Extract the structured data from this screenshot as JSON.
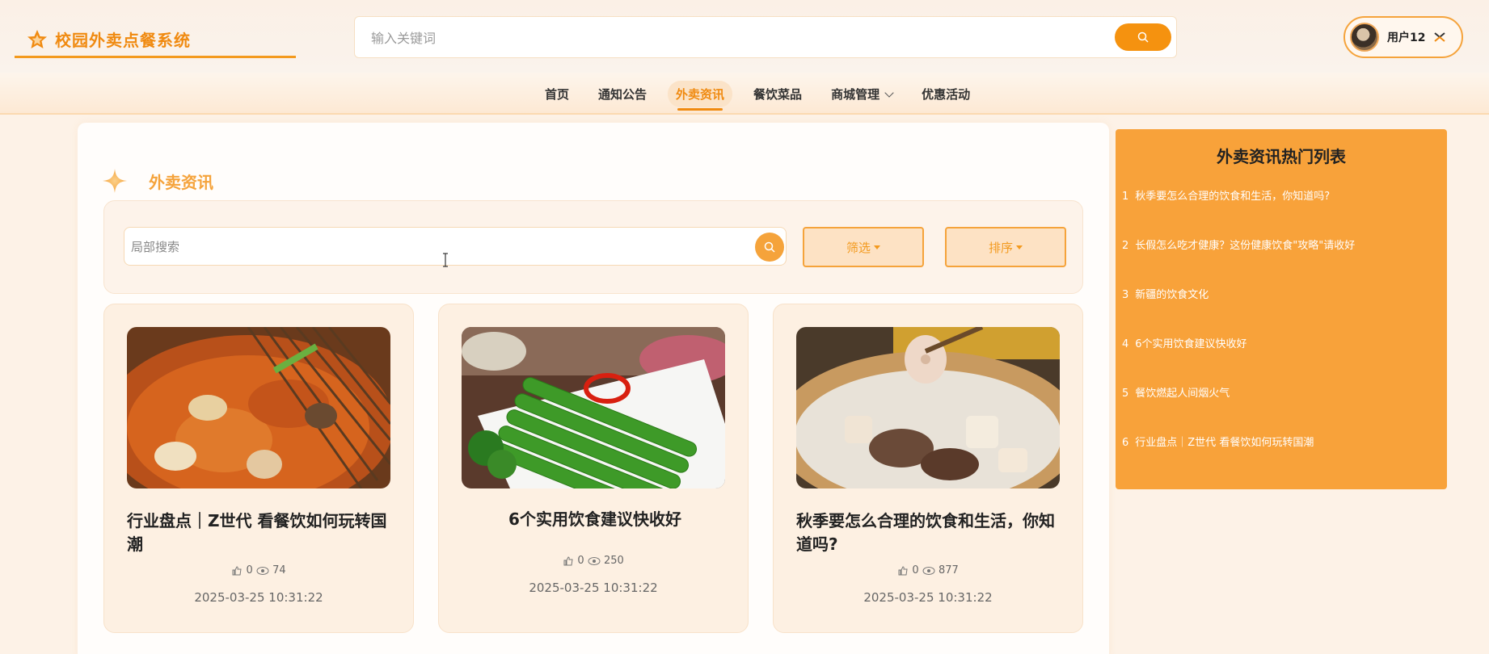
{
  "header": {
    "logo_text": "校园外卖点餐系统",
    "search_placeholder": "输入关键词",
    "user_name": "用户12"
  },
  "nav": {
    "items": [
      {
        "label": "首页"
      },
      {
        "label": "通知公告"
      },
      {
        "label": "外卖资讯",
        "active": true
      },
      {
        "label": "餐饮菜品"
      },
      {
        "label": "商城管理",
        "has_dropdown": true
      },
      {
        "label": "优惠活动"
      }
    ]
  },
  "main": {
    "section_title": "外卖资讯",
    "local_search_placeholder": "局部搜索",
    "filter_label": "筛选",
    "sort_label": "排序",
    "cards": [
      {
        "title": "行业盘点｜Z世代 看餐饮如何玩转国潮",
        "likes": "0",
        "views": "74",
        "date": "2025-03-25 10:31:22",
        "image": "spicy-skewer-hotpot"
      },
      {
        "title": "6个实用饮食建议快收好",
        "likes": "0",
        "views": "250",
        "date": "2025-03-25 10:31:22",
        "image": "green-vegetable-dish"
      },
      {
        "title": "秋季要怎么合理的饮食和生活，你知道吗?",
        "likes": "0",
        "views": "877",
        "date": "2025-03-25 10:31:22",
        "image": "lotus-root-soup"
      }
    ]
  },
  "sidebar": {
    "title": "外卖资讯热门列表",
    "items": [
      {
        "num": "1",
        "text": "秋季要怎么合理的饮食和生活，你知道吗?"
      },
      {
        "num": "2",
        "text": "长假怎么吃才健康？这份健康饮食\"攻略\"请收好"
      },
      {
        "num": "3",
        "text": "新疆的饮食文化"
      },
      {
        "num": "4",
        "text": "6个实用饮食建议快收好"
      },
      {
        "num": "5",
        "text": "餐饮燃起人间烟火气"
      },
      {
        "num": "6",
        "text": "行业盘点｜Z世代 看餐饮如何玩转国潮"
      }
    ]
  },
  "colors": {
    "accent": "#f5920f",
    "brand_text": "#f08a10",
    "sidebar_bg": "#f8a23a",
    "card_bg": "#fdf0e2"
  }
}
